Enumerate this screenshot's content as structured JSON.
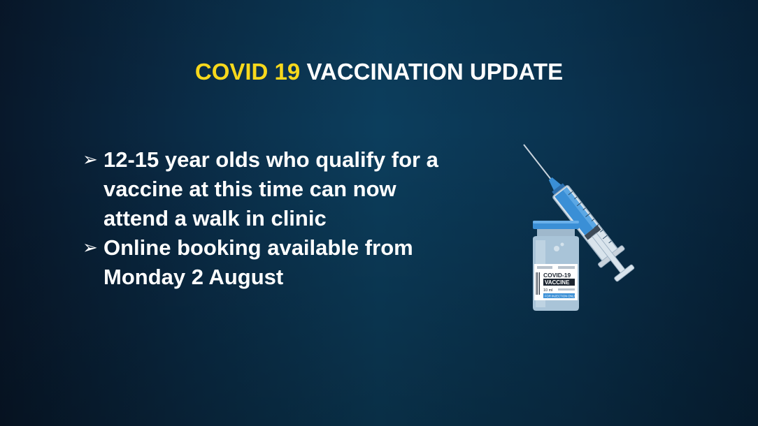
{
  "title": {
    "highlight": "COVID 19",
    "rest": "VACCINATION UPDATE"
  },
  "bullets": [
    {
      "marker": "➢",
      "lines": [
        "12-15 year olds who qualify for a",
        "vaccine at this time can now",
        "attend a walk in clinic"
      ]
    },
    {
      "marker": "➢",
      "lines": [
        "Online booking available from",
        "Monday 2 August"
      ]
    }
  ],
  "vial": {
    "label_main": "COVID-19",
    "label_sub": "VACCINE",
    "volume": "10 ml",
    "strip_text": "FOR INJECTION ONLY"
  },
  "colors": {
    "title_highlight": "#f7d81c",
    "text": "#ffffff",
    "vial_cap": "#3a8fd6",
    "syringe_liquid": "#3a8fd6"
  },
  "icons": [
    "syringe-icon",
    "vaccine-vial-icon"
  ]
}
